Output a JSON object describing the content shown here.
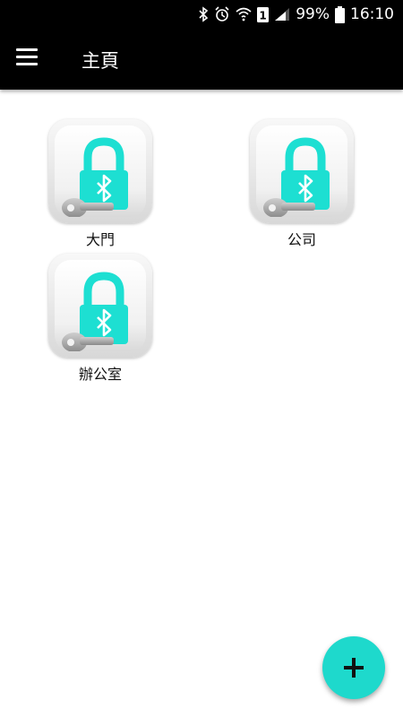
{
  "status_bar": {
    "battery": "99%",
    "time": "16:10",
    "icons": [
      "bluetooth-icon",
      "alarm-icon",
      "wifi-icon",
      "sim-1-icon",
      "signal-icon",
      "battery-icon"
    ]
  },
  "app_bar": {
    "title": "主頁",
    "menu_icon": "hamburger-menu-icon"
  },
  "locks": [
    {
      "label": "大門",
      "icon": "bluetooth-lock-key-icon"
    },
    {
      "label": "公司",
      "icon": "bluetooth-lock-key-icon"
    },
    {
      "label": "辦公室",
      "icon": "bluetooth-lock-key-icon"
    }
  ],
  "fab": {
    "icon": "plus-icon",
    "color": "#1ed9cc"
  },
  "colors": {
    "accent": "#1ed9cc",
    "lock_body": "#1ddfd2",
    "app_bar": "#000000"
  }
}
